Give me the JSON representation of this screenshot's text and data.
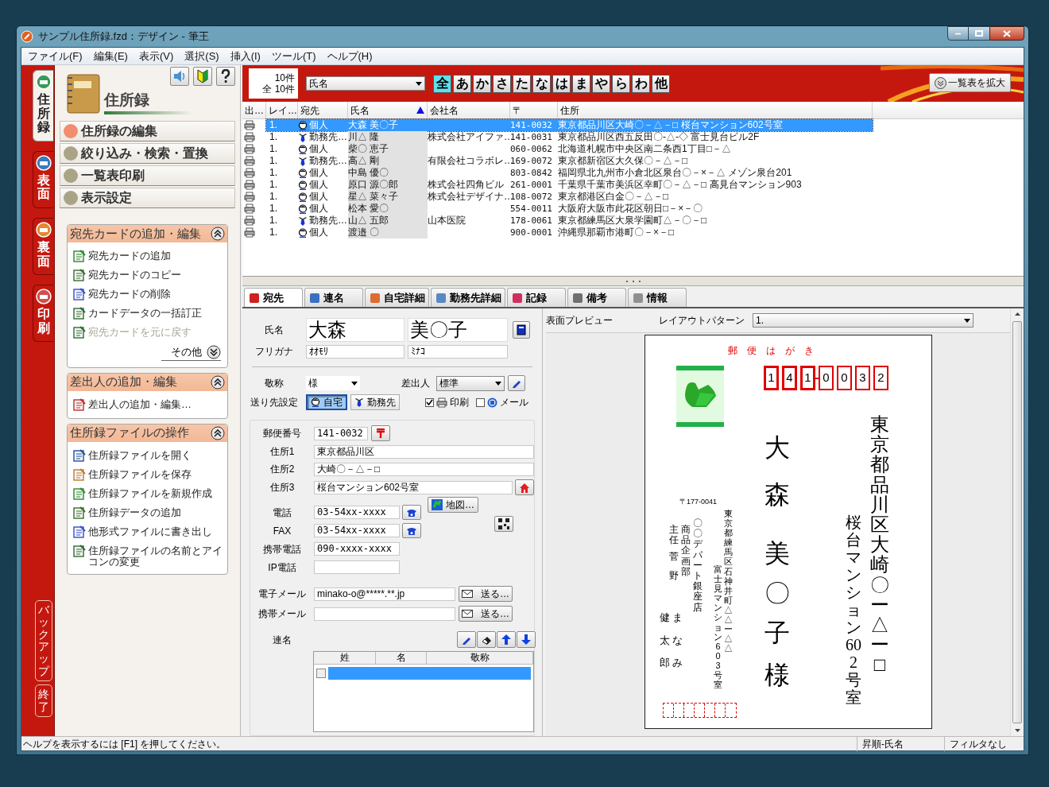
{
  "window": {
    "title": "サンプル住所録.fzd：デザイン - 筆王"
  },
  "menu": [
    "ファイル(F)",
    "編集(E)",
    "表示(V)",
    "選択(S)",
    "挿入(I)",
    "ツール(T)",
    "ヘルプ(H)"
  ],
  "mode_tabs": [
    {
      "label": "住所録",
      "selected": true
    },
    {
      "label": "表面",
      "selected": false
    },
    {
      "label": "裏面",
      "selected": false
    },
    {
      "label": "印刷",
      "selected": false
    }
  ],
  "bottom_tabs": [
    "バックアップ",
    "終了"
  ],
  "panel": {
    "title": "住所録",
    "nav": [
      {
        "label": "住所録の編集",
        "selected": true
      },
      {
        "label": "絞り込み・検索・置換",
        "selected": false
      },
      {
        "label": "一覧表印刷",
        "selected": false
      },
      {
        "label": "表示設定",
        "selected": false
      }
    ],
    "sections": [
      {
        "title": "宛先カードの追加・編集",
        "expanded": true,
        "items": [
          {
            "label": "宛先カードの追加",
            "disabled": false
          },
          {
            "label": "宛先カードのコピー",
            "disabled": false
          },
          {
            "label": "宛先カードの削除",
            "disabled": false
          },
          {
            "label": "カードデータの一括訂正",
            "disabled": false
          },
          {
            "label": "宛先カードを元に戻す",
            "disabled": true
          }
        ],
        "more": "その他"
      },
      {
        "title": "差出人の追加・編集",
        "expanded": true,
        "items": [
          {
            "label": "差出人の追加・編集…",
            "disabled": false
          }
        ]
      },
      {
        "title": "住所録ファイルの操作",
        "expanded": true,
        "items": [
          {
            "label": "住所録ファイルを開く",
            "disabled": false
          },
          {
            "label": "住所録ファイルを保存",
            "disabled": false
          },
          {
            "label": "住所録ファイルを新規作成",
            "disabled": false
          },
          {
            "label": "住所録データの追加",
            "disabled": false
          },
          {
            "label": "他形式ファイルに書き出し",
            "disabled": false
          },
          {
            "label": "住所録ファイルの名前とアイコンの変更",
            "disabled": false
          }
        ]
      }
    ]
  },
  "toolbar": {
    "count": "10件",
    "total": "全 10件",
    "sort_field": "氏名",
    "kana": [
      {
        "label": "全",
        "selected": true
      },
      {
        "label": "あ",
        "selected": false
      },
      {
        "label": "か",
        "selected": false
      },
      {
        "label": "さ",
        "selected": false
      },
      {
        "label": "た",
        "selected": false
      },
      {
        "label": "な",
        "selected": false
      },
      {
        "label": "は",
        "selected": false
      },
      {
        "label": "ま",
        "selected": false
      },
      {
        "label": "や",
        "selected": false
      },
      {
        "label": "ら",
        "selected": false
      },
      {
        "label": "わ",
        "selected": false
      },
      {
        "label": "他",
        "selected": false
      }
    ],
    "expand_button": "一覧表を拡大"
  },
  "table": {
    "columns": [
      {
        "label": "出…",
        "sorted": false
      },
      {
        "label": "レイ…",
        "sorted": false
      },
      {
        "label": "宛先",
        "sorted": false
      },
      {
        "label": "氏名",
        "sorted": true
      },
      {
        "label": "会社名",
        "sorted": false
      },
      {
        "label": "〒",
        "sorted": false
      },
      {
        "label": "住所",
        "sorted": false
      }
    ],
    "rows": [
      {
        "layout": "1.",
        "kind": "home",
        "dest": "個人",
        "name": "大森 美〇子",
        "zip": "141-0032",
        "address": "東京都品川区大崎〇－△－□ 桜台マンション602号室",
        "selected": true
      },
      {
        "layout": "1.",
        "kind": "work",
        "dest": "勤務先…",
        "name": "川△ 隆",
        "company": "株式会社アイファ…",
        "zip": "141-0031",
        "address": "東京都品川区西五反田〇-△-◇ 富士見台ビル2F",
        "selected": false
      },
      {
        "layout": "1.",
        "kind": "home",
        "dest": "個人",
        "name": "柴〇 恵子",
        "zip": "060-0062",
        "address": "北海道札幌市中央区南二条西1丁目□－△",
        "selected": false
      },
      {
        "layout": "1.",
        "kind": "work",
        "dest": "勤務先…",
        "name": "高△ 剛",
        "company": "有限会社コラボレ…",
        "zip": "169-0072",
        "address": "東京都新宿区大久保〇－△－□",
        "selected": false
      },
      {
        "layout": "1.",
        "kind": "home",
        "dest": "個人",
        "name": "中島 優〇",
        "zip": "803-0842",
        "address": "福岡県北九州市小倉北区泉台〇－×－△ メゾン泉台201",
        "selected": false
      },
      {
        "layout": "1.",
        "kind": "home",
        "dest": "個人",
        "name": "原口 源〇郎",
        "company": "株式会社四角ビル",
        "zip": "261-0001",
        "address": "千葉県千葉市美浜区幸町〇－△－□ 高見台マンション903",
        "selected": false
      },
      {
        "layout": "1.",
        "kind": "home",
        "dest": "個人",
        "name": "星△ 菜々子",
        "company": "株式会社デザイナ…",
        "zip": "108-0072",
        "address": "東京都港区白金〇－△－□",
        "selected": false
      },
      {
        "layout": "1.",
        "kind": "home",
        "dest": "個人",
        "name": "松本 愛〇",
        "zip": "554-0011",
        "address": "大阪府大阪市此花区朝日□－×－〇",
        "selected": false
      },
      {
        "layout": "1.",
        "kind": "work",
        "dest": "勤務先…",
        "name": "山△ 五郎",
        "company": "山本医院",
        "zip": "178-0061",
        "address": "東京都練馬区大泉学園町△－〇－□",
        "selected": false
      },
      {
        "layout": "1.",
        "kind": "home",
        "dest": "個人",
        "name": "渡邉 〇",
        "zip": "900-0001",
        "address": "沖縄県那覇市港町〇－×－□",
        "selected": false
      }
    ]
  },
  "form_tabs": [
    {
      "label": "宛先",
      "selected": true
    },
    {
      "label": "連名",
      "selected": false
    },
    {
      "label": "自宅詳細",
      "selected": false
    },
    {
      "label": "勤務先詳細",
      "selected": false
    },
    {
      "label": "記録",
      "selected": false
    },
    {
      "label": "備考",
      "selected": false
    },
    {
      "label": "情報",
      "selected": false
    }
  ],
  "form": {
    "name": {
      "label": "氏名",
      "last": "大森",
      "first": "美〇子"
    },
    "furigana": {
      "label": "フリガナ",
      "last": "ｵｵﾓﾘ",
      "first": "ﾐﾅｺ"
    },
    "honorific": {
      "label": "敬称",
      "value": "様"
    },
    "sender": {
      "label": "差出人",
      "value": "標準"
    },
    "destination": {
      "label": "送り先設定",
      "options": [
        {
          "kind": "home",
          "label": "自宅",
          "selected": true
        },
        {
          "kind": "work",
          "label": "勤務先",
          "selected": false
        }
      ]
    },
    "print": {
      "label": "印刷",
      "checked": true
    },
    "mail": {
      "label": "メール",
      "checked": false
    },
    "zip": {
      "label": "郵便番号",
      "value": "141-0032"
    },
    "addresses": [
      {
        "label": "住所1",
        "value": "東京都品川区"
      },
      {
        "label": "住所2",
        "value": "大崎〇－△－□"
      },
      {
        "label": "住所3",
        "value": "桜台マンション602号室"
      }
    ],
    "map_button": "地図…",
    "phones": [
      {
        "label": "電話",
        "value": "03-54xx-xxxx",
        "dial": true
      },
      {
        "label": "FAX",
        "value": "03-54xx-xxxx",
        "dial": true
      },
      {
        "label": "携帯電話",
        "value": "090-xxxx-xxxx",
        "dial": false
      },
      {
        "label": "IP電話",
        "dial": false
      }
    ],
    "emails": [
      {
        "label": "電子メール",
        "value": "minako-o@*****.**.jp",
        "button": "送る…"
      },
      {
        "label": "携帯メール",
        "button": "送る…"
      }
    ],
    "joint": {
      "label": "連名",
      "columns": [
        "姓",
        "名",
        "敬称"
      ],
      "rows": [
        {
          "checked": false,
          "selected": true
        }
      ]
    }
  },
  "preview": {
    "label": "表面プレビュー",
    "layout_label": "レイアウトパターン",
    "layout_value": "1.",
    "postcard": {
      "header": "郵便はがき",
      "zip_digits": [
        "1",
        "4",
        "1",
        "0",
        "0",
        "3",
        "2"
      ],
      "address1": "東京都品川区大崎〇ー△ー□",
      "address2": "桜台マンション602号室",
      "last_name": "大森",
      "first_name": "美〇子",
      "honorific": "様",
      "sender": {
        "zip": "〒177-0041",
        "address1": "東京都練馬区石神井町△△ー△△",
        "address2": "富士見マンション603号室",
        "company": "〇〇デパート銀座店",
        "department": "商品企画部",
        "title": "主任",
        "name": "菅野",
        "joint": [
          "健太郎",
          "まなみ"
        ]
      }
    }
  },
  "status_bar": {
    "help": "ヘルプを表示するには [F1] を押してください。",
    "sort": "昇順-氏名",
    "filter": "フィルタなし"
  }
}
